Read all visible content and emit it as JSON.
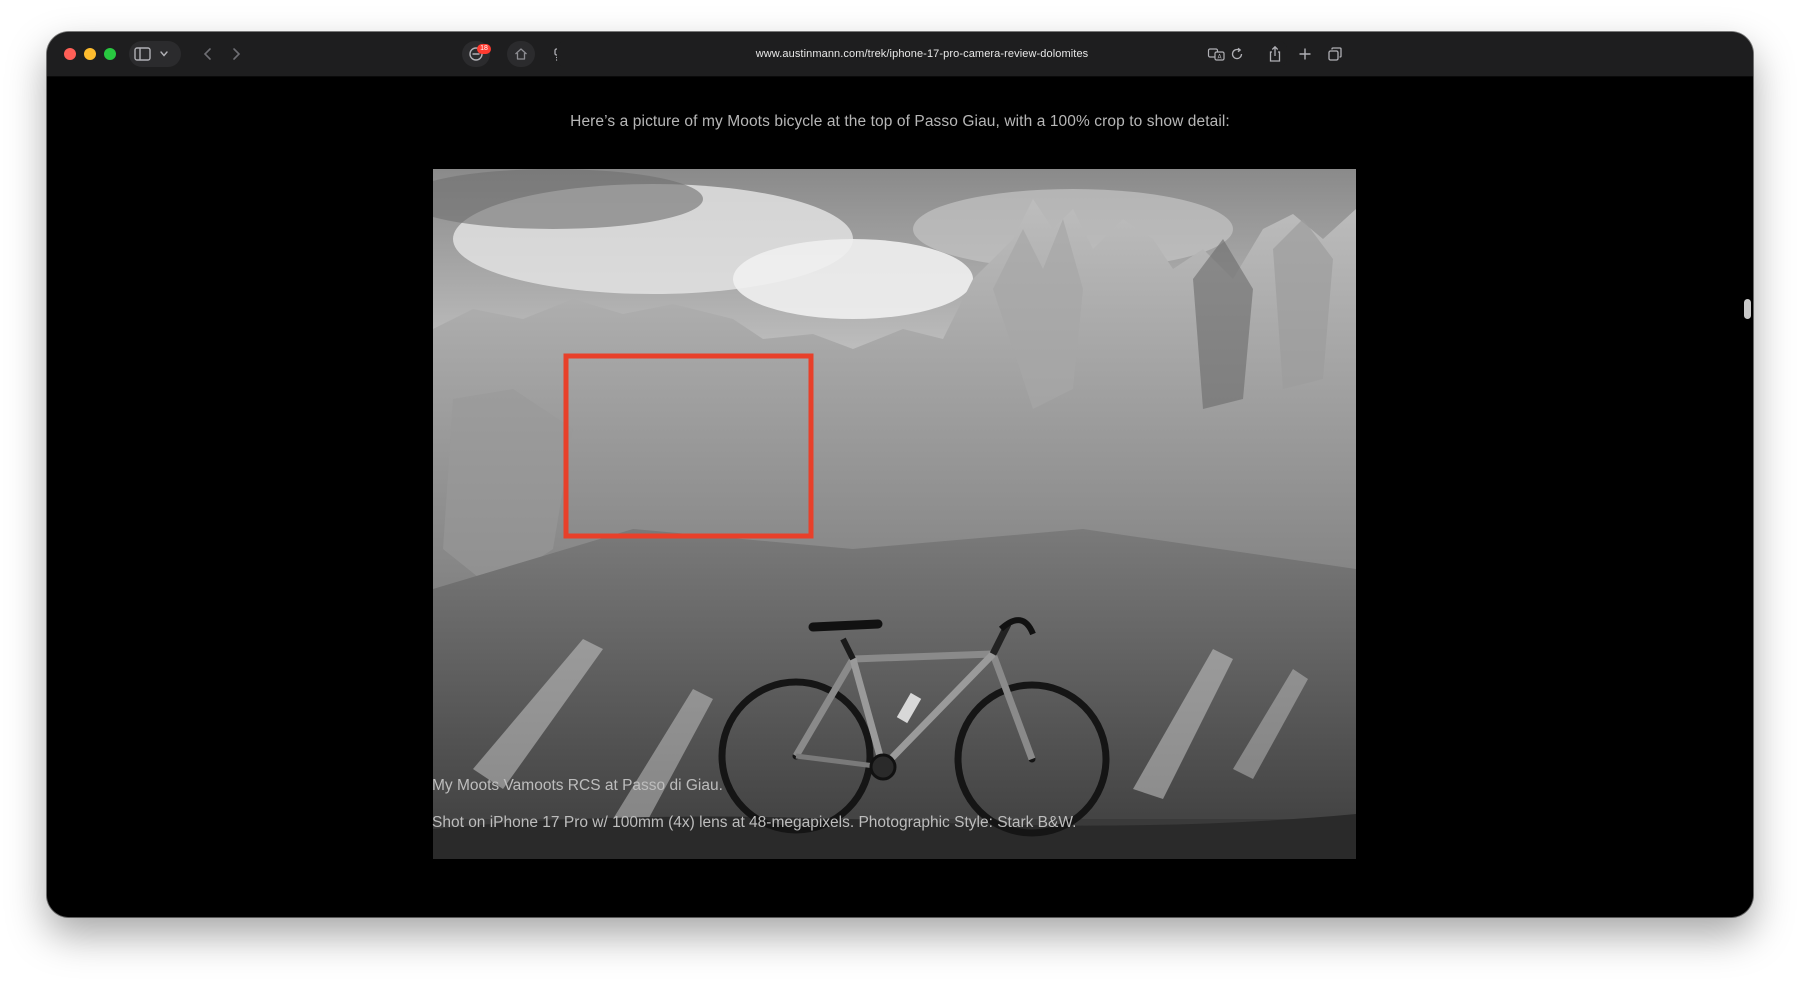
{
  "browser": {
    "url": "www.austinmann.com/trek/iphone-17-pro-camera-review-dolomites",
    "extension_badge": "18",
    "traffic_colors": [
      "#ff5f57",
      "#febc2e",
      "#28c840"
    ]
  },
  "article": {
    "intro_text": "Here’s a picture of my Moots bicycle at the top of Passo Giau, with a 100% crop to show detail:",
    "caption_line1": "My Moots Vamoots RCS at Passo di Giau.",
    "caption_line2": "Shot on iPhone 17 Pro w/ 100mm (4x) lens at 48-megapixels. Photographic Style: Stark B&W.",
    "crop_highlight_color": "#e8402a"
  }
}
